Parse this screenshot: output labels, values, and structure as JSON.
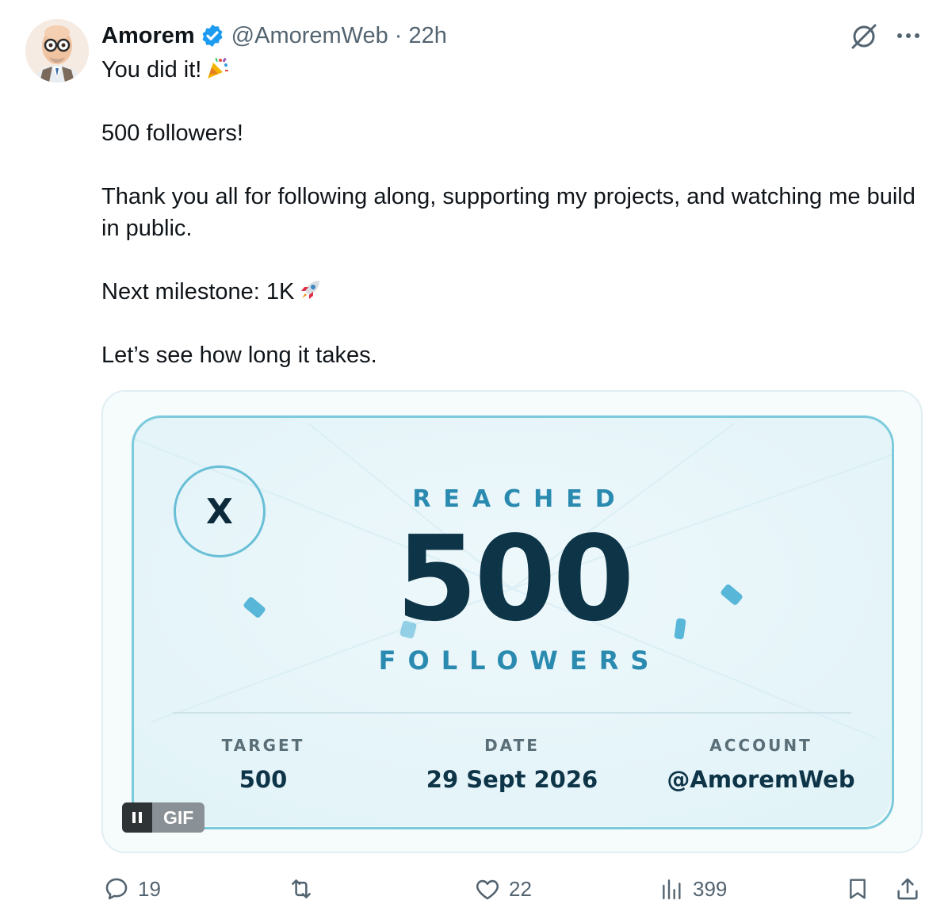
{
  "author": {
    "name": "Amorem",
    "handle": "@AmoremWeb",
    "separator": "·",
    "time": "22h"
  },
  "tweet": {
    "line1": "You did it!",
    "line2": "500 followers!",
    "line3": "Thank you all for following along, supporting my projects, and watching me build in public.",
    "line4": "Next milestone: 1K",
    "line5": "Let’s see how long it takes."
  },
  "media": {
    "logo_letter": "X",
    "reached": "REACHED",
    "number": "500",
    "followers": "FOLLOWERS",
    "target_label": "TARGET",
    "target_value": "500",
    "date_label": "DATE",
    "date_value": "29 Sept 2026",
    "account_label": "ACCOUNT",
    "account_value": "@AmoremWeb",
    "gif_label": "GIF"
  },
  "actions": {
    "replies": "19",
    "retweets": "",
    "likes": "22",
    "views": "399"
  },
  "colors": {
    "verified": "#1d9bf0",
    "card_border": "#7ccbdc",
    "accent_text": "#2b8ab0",
    "number": "#0d3447",
    "muted": "#536471"
  }
}
